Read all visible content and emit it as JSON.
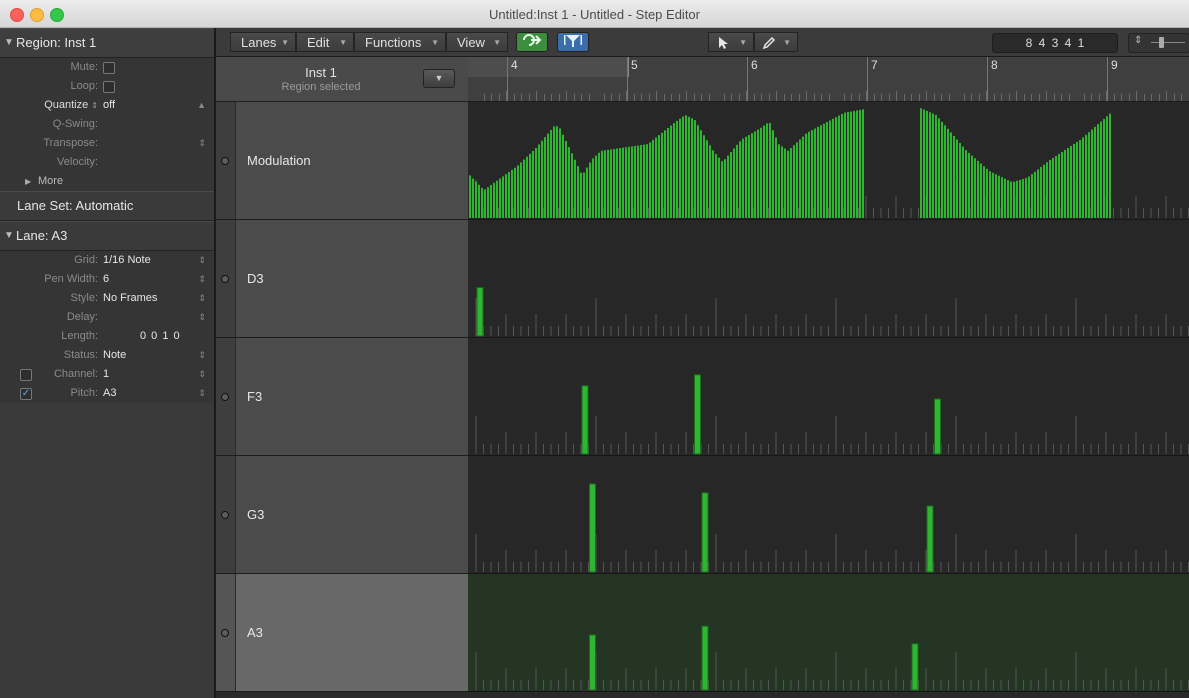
{
  "window": {
    "title": "Untitled:Inst 1 - Untitled - Step Editor"
  },
  "inspector": {
    "region_header": "Region: Inst 1",
    "rows": [
      {
        "label": "Mute:",
        "type": "checkbox",
        "checked": false
      },
      {
        "label": "Loop:",
        "type": "checkbox",
        "checked": false
      },
      {
        "label": "Quantize",
        "type": "select",
        "value": "off"
      },
      {
        "label": "Q-Swing:",
        "type": "disabled",
        "value": ""
      },
      {
        "label": "Transpose:",
        "type": "select",
        "value": ""
      },
      {
        "label": "Velocity:",
        "type": "disabled",
        "value": ""
      }
    ],
    "more_label": "More",
    "lane_set": "Lane Set: Automatic",
    "lane_header": "Lane:  A3",
    "lane_rows": {
      "grid": {
        "label": "Grid:",
        "value": "1/16 Note"
      },
      "pen_width": {
        "label": "Pen Width:",
        "value": "6"
      },
      "style": {
        "label": "Style:",
        "value": "No Frames"
      },
      "delay": {
        "label": "Delay:",
        "value": ""
      },
      "length": {
        "label": "Length:",
        "value": "0 0 1    0"
      },
      "status": {
        "label": "Status:",
        "value": "Note"
      },
      "channel": {
        "label": "Channel:",
        "value": "1",
        "checked": false
      },
      "pitch": {
        "label": "Pitch:",
        "value": "A3",
        "checked": true
      }
    }
  },
  "toolbar": {
    "menus": [
      "Lanes",
      "Edit",
      "Functions",
      "View"
    ],
    "position_display": "8  4 3 4 1"
  },
  "header": {
    "title": "Inst 1",
    "subtitle": "Region selected"
  },
  "ruler": {
    "bars": [
      "4",
      "5",
      "6",
      "7",
      "8",
      "9"
    ]
  },
  "colors": {
    "step_green": "#2fb532",
    "selected_lane_bg": "#243524"
  },
  "lanes": [
    {
      "name": "Modulation",
      "selected": false
    },
    {
      "name": "D3",
      "selected": false
    },
    {
      "name": "F3",
      "selected": false
    },
    {
      "name": "G3",
      "selected": false
    },
    {
      "name": "A3",
      "selected": true
    }
  ],
  "step_values": {
    "D3": [
      {
        "step": 1,
        "value": 0.44
      }
    ],
    "F3": [
      {
        "step": 15,
        "value": 0.62
      },
      {
        "step": 30,
        "value": 0.72
      },
      {
        "step": 62,
        "value": 0.5
      }
    ],
    "G3": [
      {
        "step": 16,
        "value": 0.8
      },
      {
        "step": 31,
        "value": 0.72
      },
      {
        "step": 61,
        "value": 0.6
      }
    ],
    "A3": [
      {
        "step": 16,
        "value": 0.5
      },
      {
        "step": 31,
        "value": 0.58
      },
      {
        "step": 59,
        "value": 0.42
      }
    ]
  }
}
